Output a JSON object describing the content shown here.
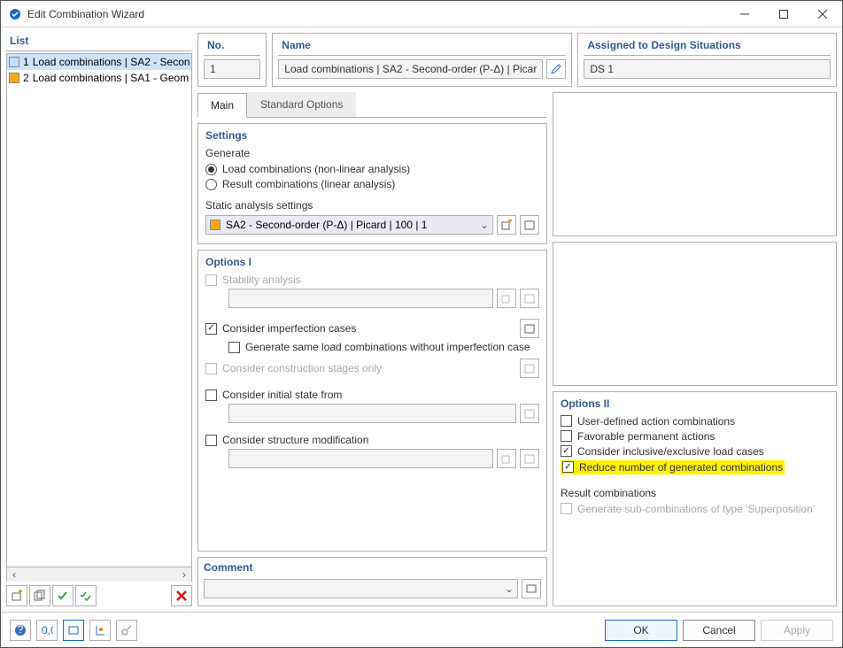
{
  "window": {
    "title": "Edit Combination Wizard"
  },
  "list": {
    "header": "List",
    "items": [
      {
        "num": "1",
        "label": "Load combinations | SA2 - Secon",
        "selected": true,
        "color": "blue"
      },
      {
        "num": "2",
        "label": "Load combinations | SA1 - Geom",
        "selected": false,
        "color": "orange"
      }
    ]
  },
  "no": {
    "header": "No.",
    "value": "1"
  },
  "name": {
    "header": "Name",
    "value": "Load combinations | SA2 - Second-order (P-Δ) | Picar"
  },
  "assigned": {
    "header": "Assigned to Design Situations",
    "value": "DS 1"
  },
  "tabs": {
    "main": "Main",
    "standard": "Standard Options"
  },
  "settings": {
    "header": "Settings",
    "generate": "Generate",
    "radio_nonlinear": "Load combinations (non-linear analysis)",
    "radio_linear": "Result combinations (linear analysis)",
    "static_label": "Static analysis settings",
    "static_value": "SA2 - Second-order (P-Δ) | Picard | 100 | 1"
  },
  "options1": {
    "header": "Options I",
    "stability": "Stability analysis",
    "consider_imperfection": "Consider imperfection cases",
    "gen_same_load": "Generate same load combinations without imperfection case",
    "consider_construction": "Consider construction stages only",
    "consider_initial": "Consider initial state from",
    "consider_structure": "Consider structure modification"
  },
  "options2": {
    "header": "Options II",
    "user_defined": "User-defined action combinations",
    "favorable": "Favorable permanent actions",
    "consider_inclusive": "Consider inclusive/exclusive load cases",
    "reduce_number": "Reduce number of generated combinations",
    "result_header": "Result combinations",
    "generate_sub": "Generate sub-combinations of type 'Superposition'"
  },
  "comment": {
    "header": "Comment"
  },
  "buttons": {
    "ok": "OK",
    "cancel": "Cancel",
    "apply": "Apply"
  }
}
